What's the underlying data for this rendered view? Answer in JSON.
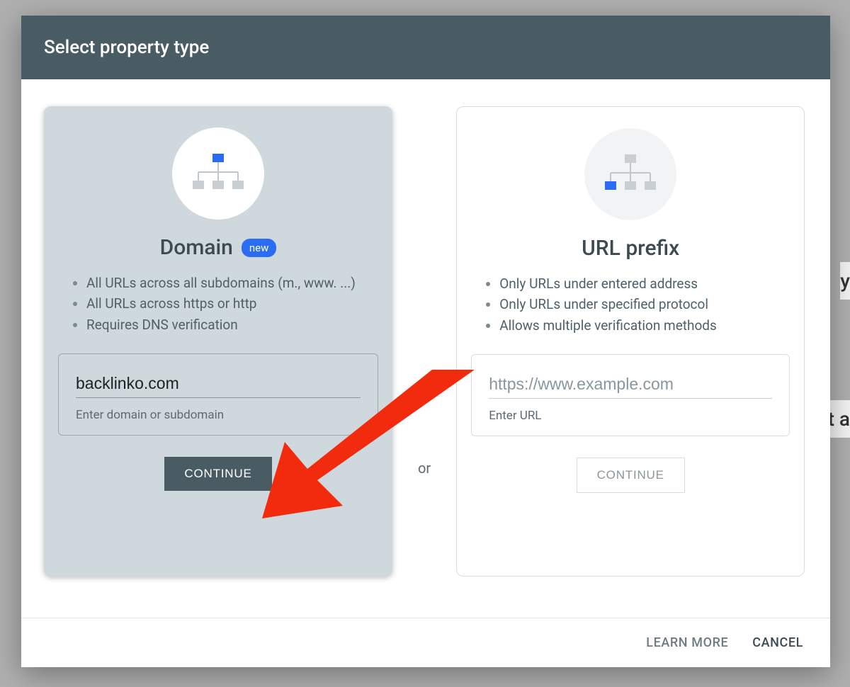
{
  "dialog": {
    "title": "Select property type",
    "or_label": "or",
    "footer": {
      "learn_more": "LEARN MORE",
      "cancel": "CANCEL"
    }
  },
  "domain_card": {
    "title": "Domain",
    "badge": "new",
    "features": [
      "All URLs across all subdomains (m., www. ...)",
      "All URLs across https or http",
      "Requires DNS verification"
    ],
    "input_value": "backlinko.com",
    "input_helper": "Enter domain or subdomain",
    "continue_label": "CONTINUE"
  },
  "url_card": {
    "title": "URL prefix",
    "features": [
      "Only URLs under entered address",
      "Only URLs under specified protocol",
      "Allows multiple verification methods"
    ],
    "input_placeholder": "https://www.example.com",
    "input_helper": "Enter URL",
    "continue_label": "CONTINUE"
  },
  "backdrop": {
    "text1": "y",
    "text2": "t a"
  }
}
